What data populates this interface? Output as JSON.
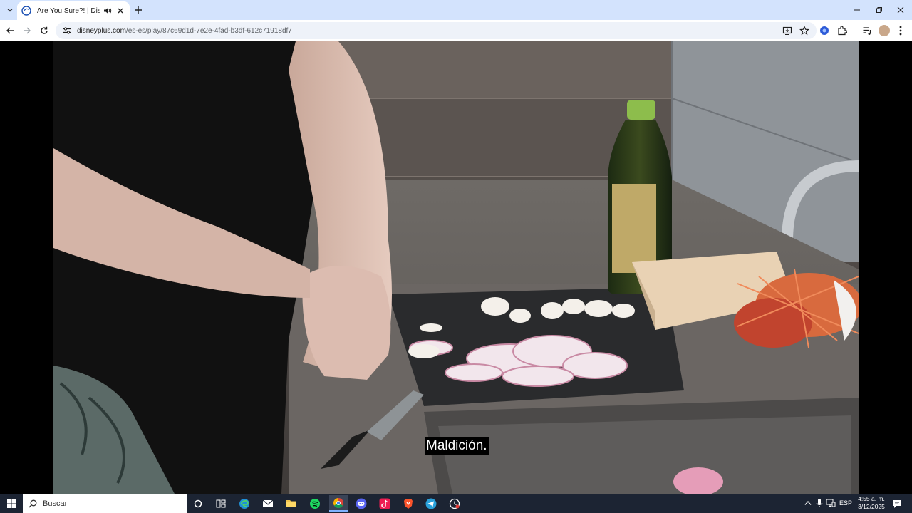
{
  "browser": {
    "tab": {
      "title": "Are You Sure?! | Disney+"
    },
    "url": {
      "domain": "disneyplus.com",
      "path": "/es-es/play/87c69d1d-7e2e-4fad-b3df-612c71918df7"
    }
  },
  "video": {
    "subtitle": "Maldición."
  },
  "taskbar": {
    "search_placeholder": "Buscar",
    "apps": [
      "task-view",
      "edge",
      "mail",
      "file-explorer",
      "spotify",
      "chrome",
      "discord",
      "tiktok",
      "brave",
      "telegram",
      "clock-app"
    ],
    "active_app": "chrome",
    "language": "ESP",
    "time": "4:55 a. m.",
    "date": "3/12/2025"
  },
  "colors": {
    "tabstrip": "#d3e3fd",
    "taskbar": "#1c2433",
    "accent": "#0b57d0"
  }
}
